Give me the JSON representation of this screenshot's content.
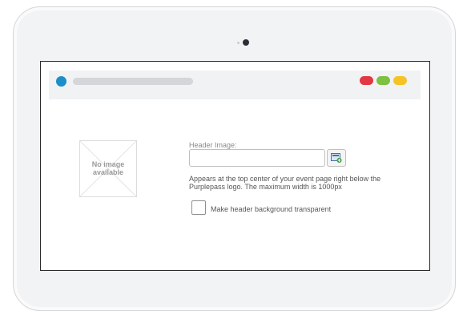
{
  "window": {
    "favicon_color": "#1a8fc9",
    "controls": [
      {
        "name": "close",
        "color": "#e23744"
      },
      {
        "name": "minimize",
        "color": "#7cc142"
      },
      {
        "name": "maximize",
        "color": "#f6c324"
      }
    ]
  },
  "preview": {
    "placeholder_text": "No image\navailable"
  },
  "form": {
    "header_image_label": "Header Image:",
    "header_image_value": "",
    "browse_icon": "image-browse-icon",
    "help_text": "Appears at the top center of your event page right below the Purplepass logo. The maximum width is 1000px",
    "transparent_label": "Make header background transparent",
    "transparent_checked": false
  }
}
